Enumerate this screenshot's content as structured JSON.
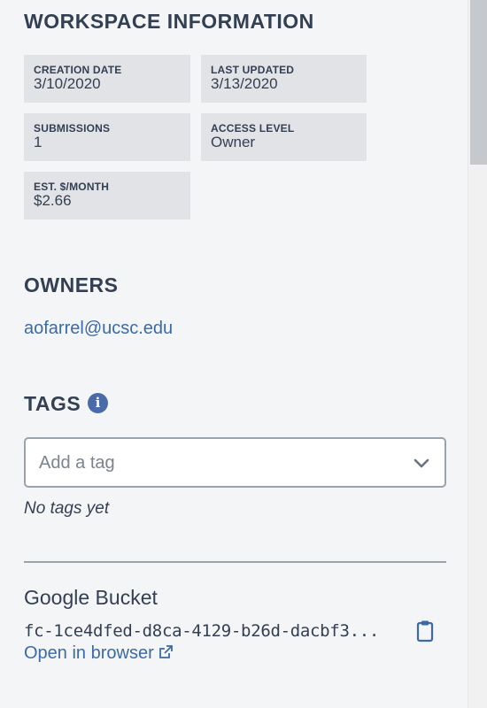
{
  "workspace_info": {
    "title": "WORKSPACE INFORMATION",
    "cards": [
      {
        "label": "CREATION DATE",
        "value": "3/10/2020"
      },
      {
        "label": "LAST UPDATED",
        "value": "3/13/2020"
      },
      {
        "label": "SUBMISSIONS",
        "value": "1"
      },
      {
        "label": "ACCESS LEVEL",
        "value": "Owner"
      },
      {
        "label": "EST. $/MONTH",
        "value": "$2.66"
      }
    ]
  },
  "owners": {
    "title": "OWNERS",
    "list": [
      "aofarrel@ucsc.edu"
    ]
  },
  "tags": {
    "title": "TAGS",
    "info_icon": "info-icon",
    "input_placeholder": "Add a tag",
    "empty_text": "No tags yet"
  },
  "google_bucket": {
    "title": "Google Bucket",
    "bucket_name": "fc-1ce4dfed-d8ca-4129-b26d-dacbf3...",
    "copy_icon": "clipboard-icon",
    "open_link_label": "Open in browser",
    "open_link_icon": "external-link-icon"
  },
  "colors": {
    "background": "#f4f5f7",
    "card": "#e1e3e7",
    "text": "#333f52",
    "link": "#3c6aa6",
    "accent_icon": "#4b6aa8",
    "border": "#9aa2ad"
  }
}
